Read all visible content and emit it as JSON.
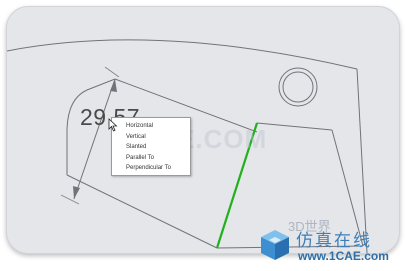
{
  "dimension": {
    "value": "29.57"
  },
  "context_menu": {
    "items": [
      "Horizontal",
      "Vertical",
      "Slanted",
      "Parallel To",
      "Perpendicular To"
    ]
  },
  "watermark": {
    "text": "1CAE.COM"
  },
  "logo": {
    "title": "仿真在线",
    "url": "www.1CAE.com",
    "sub": "3D世界"
  },
  "colors": {
    "highlight_edge": "#22b01e",
    "background": "#e4e6ea",
    "lines": "#6e7278"
  }
}
